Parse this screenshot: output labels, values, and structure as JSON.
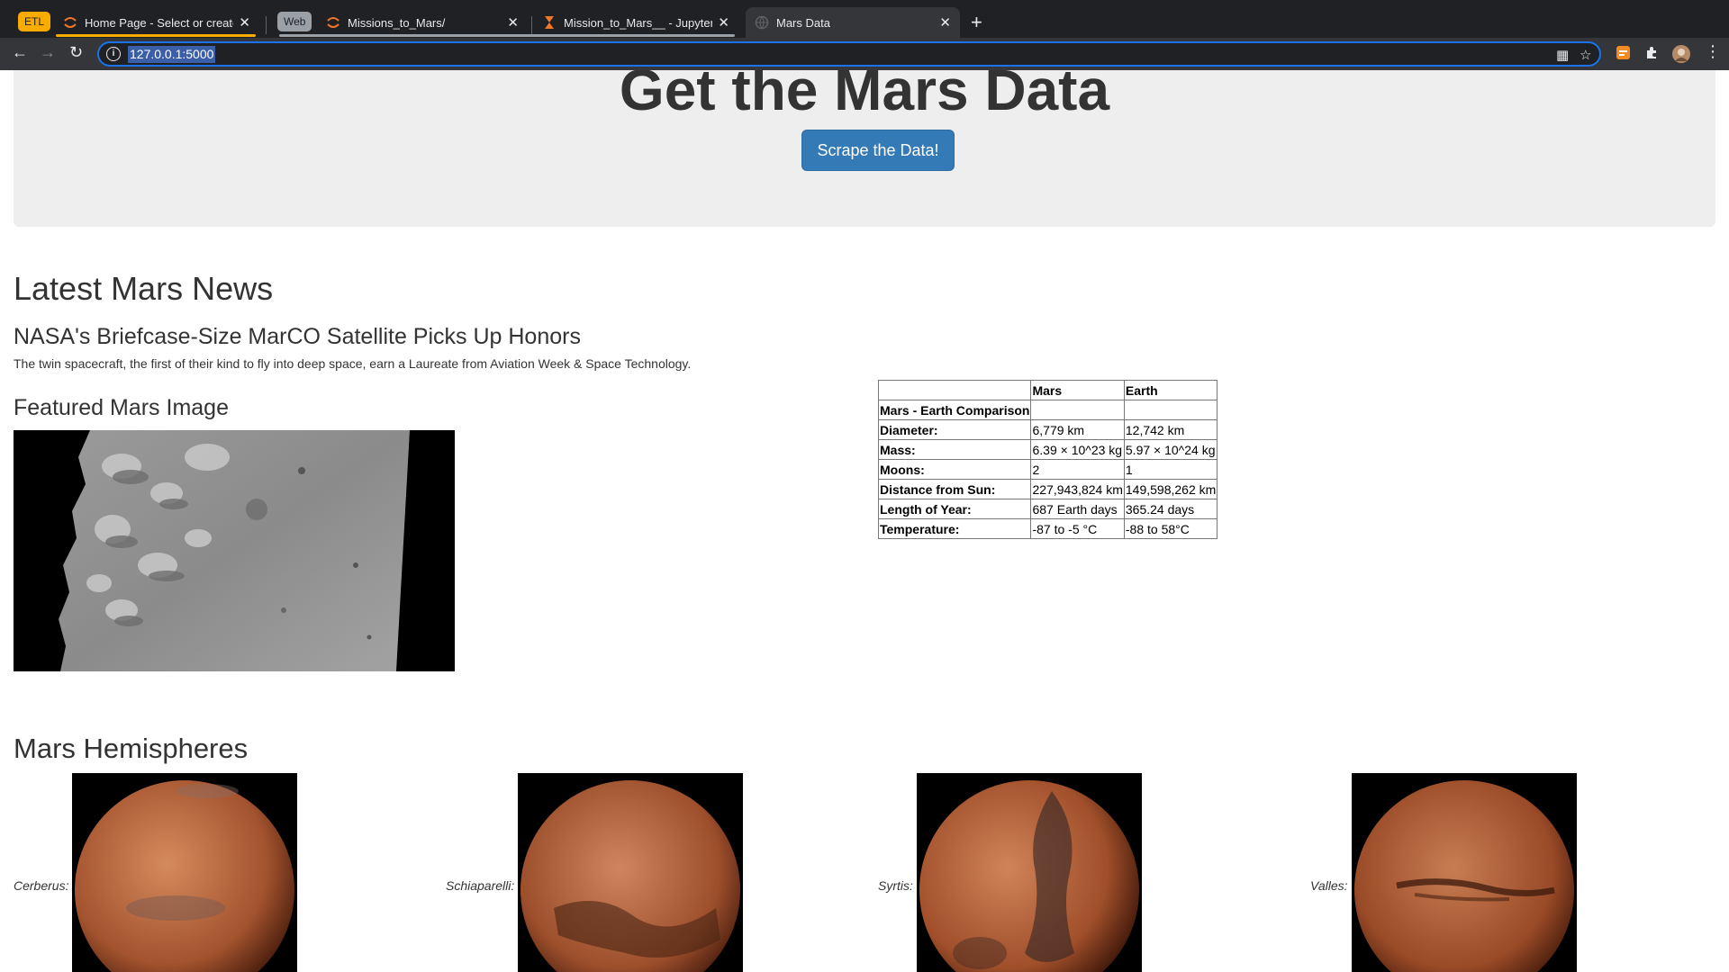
{
  "browser": {
    "groups": [
      {
        "label": "ETL",
        "color": "#f9ab00",
        "text_color": "#202124"
      },
      {
        "label": "Web",
        "color": "#9aa0a6",
        "text_color": "#202124"
      }
    ],
    "tabs": [
      {
        "title": "Home Page - Select or create a",
        "favicon": "jupyter-icon"
      },
      {
        "title": "Missions_to_Mars/",
        "favicon": "jupyter-icon"
      },
      {
        "title": "Mission_to_Mars__ - Jupyter Notebook",
        "favicon": "hourglass-icon"
      },
      {
        "title": "Mars Data",
        "favicon": "globe-icon"
      }
    ],
    "new_tab": "+",
    "url": "127.0.0.1:5000"
  },
  "jumbotron": {
    "title": "Get the Mars Data",
    "button_label": "Scrape the Data!"
  },
  "news": {
    "heading": "Latest Mars News",
    "title": "NASA's Briefcase-Size MarCO Satellite Picks Up Honors",
    "paragraph": "The twin spacecraft, the first of their kind to fly into deep space, earn a Laureate from Aviation Week & Space Technology."
  },
  "featured": {
    "heading": "Featured Mars Image"
  },
  "facts": {
    "columns": [
      "",
      "Mars",
      "Earth"
    ],
    "rows": [
      [
        "Mars - Earth Comparison",
        "",
        ""
      ],
      [
        "Diameter:",
        "6,779 km",
        "12,742 km"
      ],
      [
        "Mass:",
        "6.39 × 10^23 kg",
        "5.97 × 10^24 kg"
      ],
      [
        "Moons:",
        "2",
        "1"
      ],
      [
        "Distance from Sun:",
        "227,943,824 km",
        "149,598,262 km"
      ],
      [
        "Length of Year:",
        "687 Earth days",
        "365.24 days"
      ],
      [
        "Temperature:",
        "-87 to -5 °C",
        "-88 to 58°C"
      ]
    ]
  },
  "hemispheres": {
    "heading": "Mars Hemispheres",
    "items": [
      {
        "label": "Cerberus:"
      },
      {
        "label": "Schiaparelli:"
      },
      {
        "label": "Syrtis:"
      },
      {
        "label": "Valles:"
      }
    ]
  },
  "colors": {
    "primary_button": "#337ab7",
    "jumbotron_bg": "#eeeeee",
    "chrome_dark": "#202124",
    "chrome_toolbar": "#35363a"
  }
}
